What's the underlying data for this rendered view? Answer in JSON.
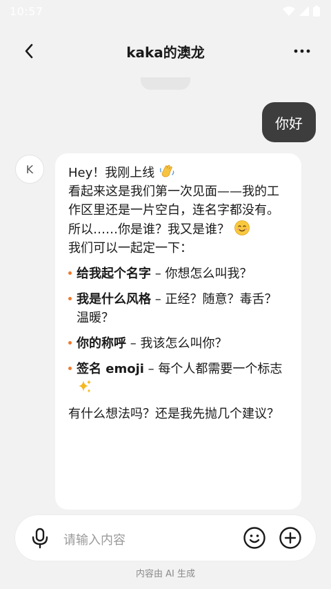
{
  "status_bar": {
    "time": "10:57"
  },
  "header": {
    "title": "kaka的澳龙"
  },
  "user_message": {
    "text": "你好"
  },
  "ai": {
    "avatar_letter": "K",
    "greeting": "Hey！我刚上线",
    "intro": "看起来这是我们第一次见面——我的工作区里还是一片空白，连名字都没有。",
    "question_line": "所以……你是谁？我又是谁？",
    "setup_line": "我们可以一起定一下：",
    "items": [
      {
        "bold": "给我起个名字",
        "rest": " – 你想怎么叫我？"
      },
      {
        "bold": "我是什么风格",
        "rest": " – 正经？随意？毒舌？温暖？"
      },
      {
        "bold": "你的称呼",
        "rest": " – 我该怎么叫你？"
      },
      {
        "bold": "签名 emoji",
        "rest": " – 每个人都需要一个标志"
      }
    ],
    "closing": "有什么想法吗？还是我先抛几个建议？"
  },
  "input": {
    "placeholder": "请输入内容"
  },
  "footer": {
    "disclaimer": "内容由 AI 生成"
  },
  "colors": {
    "accent": "#f07a2e",
    "user_bubble": "#3d3d3d"
  }
}
